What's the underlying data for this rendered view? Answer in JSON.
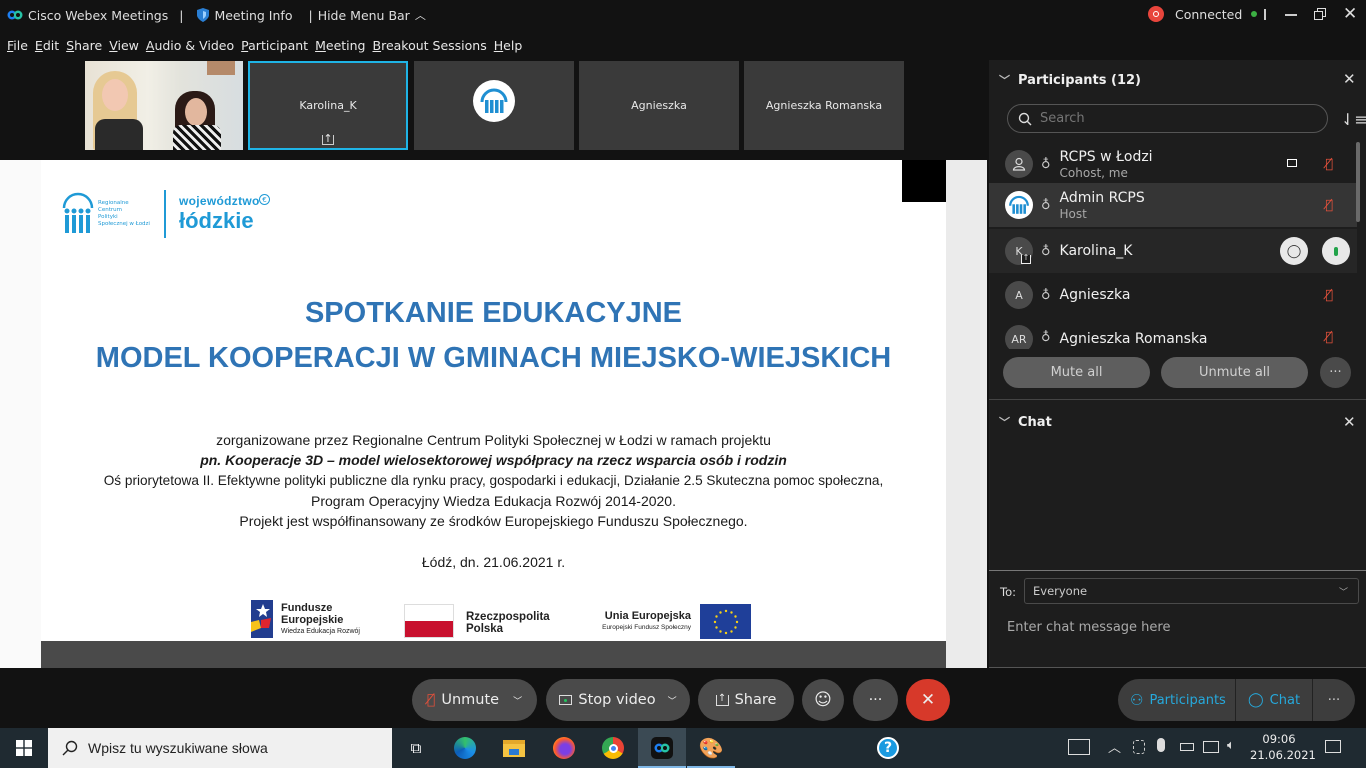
{
  "titlebar": {
    "app_name": "Cisco Webex Meetings",
    "separator": "|",
    "meeting_info": "Meeting Info",
    "hide_menu_bar": "Hide Menu Bar",
    "connection_status": "Connected",
    "status_color": "#3cb043",
    "recording_color": "#e8453c"
  },
  "menu": [
    "File",
    "Edit",
    "Share",
    "View",
    "Audio & Video",
    "Participant",
    "Meeting",
    "Breakout Sessions",
    "Help"
  ],
  "filmstrip": [
    {
      "name": "",
      "type": "video"
    },
    {
      "name": "Karolina_K",
      "type": "name",
      "sharing": true,
      "active": true
    },
    {
      "name": "",
      "type": "avatar-logo"
    },
    {
      "name": "Agnieszka",
      "type": "name"
    },
    {
      "name": "Agnieszka Romanska",
      "type": "name"
    }
  ],
  "slide": {
    "logo_left": {
      "lines": [
        "Regionalne",
        "Centrum",
        "Polityki",
        "Społecznej w Łodzi"
      ]
    },
    "logo_right": {
      "line1": "województwo",
      "line2": "łódzkie"
    },
    "title1": "SPOTKANIE EDUKACYJNE",
    "title2": "MODEL KOOPERACJI W GMINACH MIEJSKO-WIEJSKICH",
    "para1": "zorganizowane przez Regionalne Centrum Polityki Społecznej w Łodzi w ramach projektu",
    "para2": "pn. Kooperacje 3D – model wielosektorowej współpracy na rzecz wsparcia osób i rodzin",
    "para3": "Oś priorytetowa II. Efektywne polityki publiczne dla rynku pracy, gospodarki i edukacji, Działanie 2.5 Skuteczna pomoc społeczna,",
    "para4": "Program Operacyjny Wiedza Edukacja Rozwój 2014-2020.",
    "para5": "Projekt jest współfinansowany ze środków Europejskiego Funduszu Społecznego.",
    "date": "Łódź, dn. 21.06.2021 r.",
    "footer_logos": {
      "fe_line1": "Fundusze",
      "fe_line2": "Europejskie",
      "fe_line3": "Wiedza Edukacja Rozwój",
      "rp_line1": "Rzeczpospolita",
      "rp_line2": "Polska",
      "ue_line1": "Unia Europejska",
      "ue_line2": "Europejski Fundusz Społeczny"
    },
    "title_color": "#2f74b5"
  },
  "participants_panel": {
    "title": "Participants (12)",
    "search_placeholder": "Search",
    "participants": [
      {
        "initials": "",
        "name": "RCPS w Łodzi",
        "role": "Cohost, me",
        "video": true,
        "muted": true
      },
      {
        "initials": "",
        "name": "Admin RCPS",
        "role": "Host",
        "muted": true,
        "highlight": true
      },
      {
        "initials": "K",
        "name": "Karolina_K",
        "role": "",
        "muted": false,
        "sharing": true
      },
      {
        "initials": "A",
        "name": "Agnieszka",
        "role": "",
        "muted": true
      },
      {
        "initials": "AR",
        "name": "Agnieszka Romanska",
        "role": "",
        "muted": true
      }
    ],
    "mute_all": "Mute all",
    "unmute_all": "Unmute all",
    "more": "···"
  },
  "chat_panel": {
    "title": "Chat",
    "to_label": "To:",
    "to_value": "Everyone",
    "message_placeholder": "Enter chat message here"
  },
  "controls": {
    "unmute": "Unmute",
    "stop_video": "Stop video",
    "share": "Share",
    "more": "···",
    "participants": "Participants",
    "chat": "Chat",
    "end_color": "#d7392a",
    "accent": "#26a9dc"
  },
  "taskbar": {
    "search_placeholder": "Wpisz tu wyszukiwane słowa",
    "time": "09:06",
    "date": "21.06.2021"
  }
}
